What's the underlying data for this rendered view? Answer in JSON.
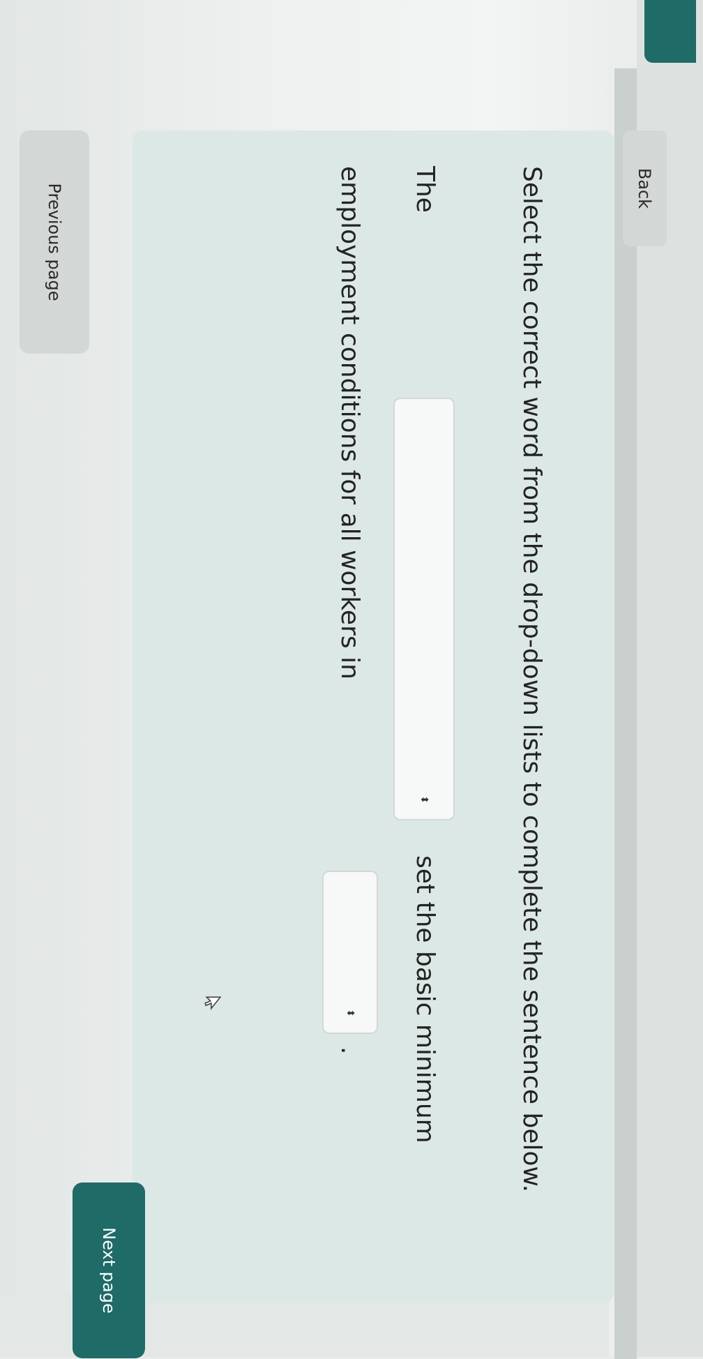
{
  "nav": {
    "back_label": "Back",
    "previous_label": "Previous page",
    "next_label": "Next page"
  },
  "question": {
    "prompt": "Select the correct word from the drop-down lists to complete the sentence below.",
    "sentence_part_1": "The",
    "sentence_part_2": "set the basic minimum",
    "sentence_part_3": "employment conditions for all workers in",
    "sentence_part_4": ".",
    "dropdown_1": {
      "selected": ""
    },
    "dropdown_2": {
      "selected": ""
    }
  },
  "colors": {
    "accent": "#1e6b68",
    "card_background": "#dce8e6",
    "button_background": "#d3d7d6"
  },
  "icons": {
    "dropdown_arrow": "chevron-up-down-icon",
    "cursor": "mouse-pointer-icon"
  }
}
